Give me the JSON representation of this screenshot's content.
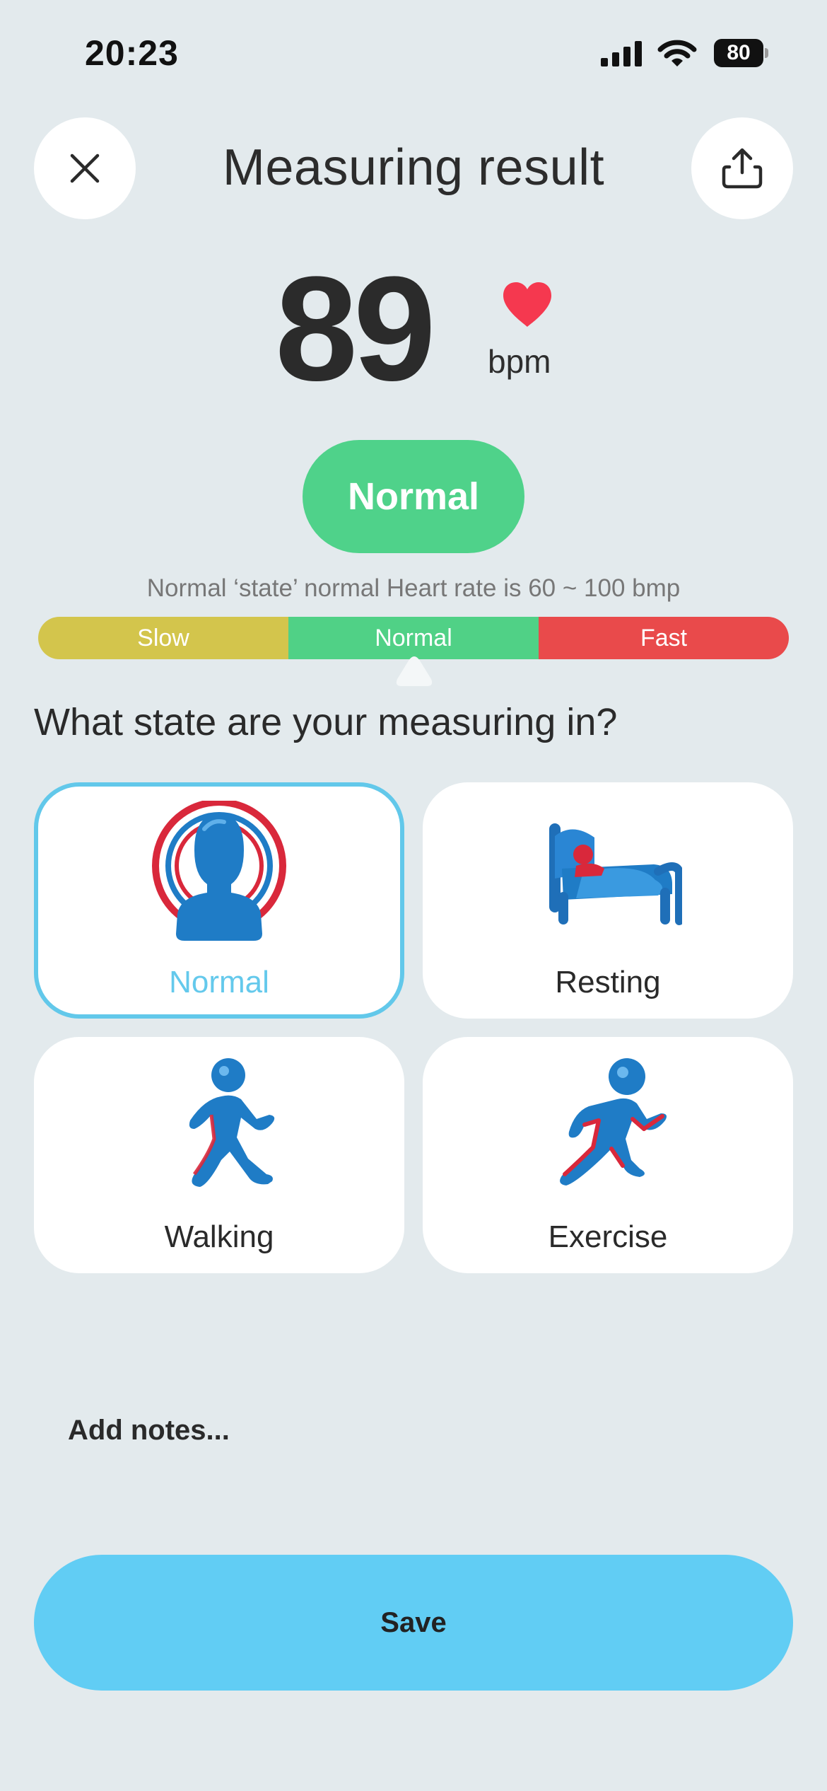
{
  "status_bar": {
    "time": "20:23",
    "battery": "80",
    "icons": [
      "cellular-signal-icon",
      "wifi-icon",
      "battery-icon"
    ]
  },
  "header": {
    "title": "Measuring result",
    "close_icon": "close-icon",
    "share_icon": "share-icon"
  },
  "reading": {
    "value": "89",
    "unit": "bpm",
    "heart_icon": "heart-icon",
    "status": "Normal",
    "range_note": "Normal ‘state’ normal Heart rate is 60 ~ 100 bmp"
  },
  "gauge": {
    "segments": [
      "Slow",
      "Normal",
      "Fast"
    ],
    "indicator_segment": "Normal"
  },
  "states": {
    "question": "What state are your measuring in?",
    "items": [
      {
        "label": "Normal",
        "icon": "person-head-icon",
        "selected": true
      },
      {
        "label": "Resting",
        "icon": "bed-icon",
        "selected": false
      },
      {
        "label": "Walking",
        "icon": "walking-person-icon",
        "selected": false
      },
      {
        "label": "Exercise",
        "icon": "running-person-icon",
        "selected": false
      }
    ]
  },
  "notes": {
    "placeholder": "Add notes..."
  },
  "actions": {
    "save_label": "Save"
  },
  "colors": {
    "background": "#e3eaed",
    "normal_green": "#4fd28a",
    "slow_yellow": "#d3c54c",
    "fast_red": "#e94a4b",
    "accent_blue": "#61cdf4",
    "heart_red": "#f5384f",
    "icon_blue": "#1f7cc6"
  }
}
